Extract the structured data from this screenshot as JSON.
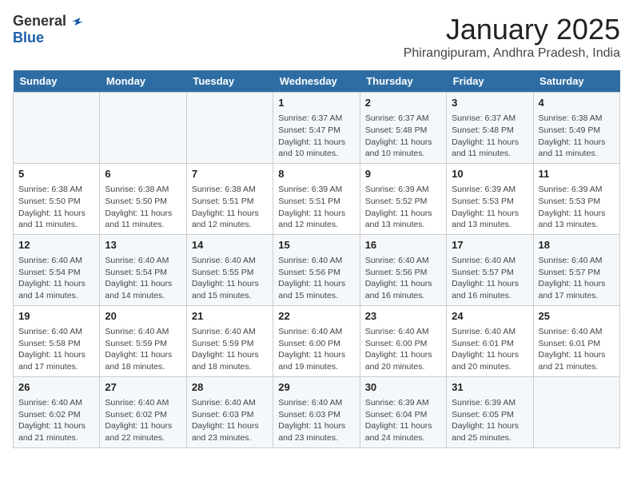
{
  "header": {
    "logo_general": "General",
    "logo_blue": "Blue",
    "month": "January 2025",
    "location": "Phirangipuram, Andhra Pradesh, India"
  },
  "days_of_week": [
    "Sunday",
    "Monday",
    "Tuesday",
    "Wednesday",
    "Thursday",
    "Friday",
    "Saturday"
  ],
  "weeks": [
    [
      {
        "day": "",
        "info": ""
      },
      {
        "day": "",
        "info": ""
      },
      {
        "day": "",
        "info": ""
      },
      {
        "day": "1",
        "info": "Sunrise: 6:37 AM\nSunset: 5:47 PM\nDaylight: 11 hours\nand 10 minutes."
      },
      {
        "day": "2",
        "info": "Sunrise: 6:37 AM\nSunset: 5:48 PM\nDaylight: 11 hours\nand 10 minutes."
      },
      {
        "day": "3",
        "info": "Sunrise: 6:37 AM\nSunset: 5:48 PM\nDaylight: 11 hours\nand 11 minutes."
      },
      {
        "day": "4",
        "info": "Sunrise: 6:38 AM\nSunset: 5:49 PM\nDaylight: 11 hours\nand 11 minutes."
      }
    ],
    [
      {
        "day": "5",
        "info": "Sunrise: 6:38 AM\nSunset: 5:50 PM\nDaylight: 11 hours\nand 11 minutes."
      },
      {
        "day": "6",
        "info": "Sunrise: 6:38 AM\nSunset: 5:50 PM\nDaylight: 11 hours\nand 11 minutes."
      },
      {
        "day": "7",
        "info": "Sunrise: 6:38 AM\nSunset: 5:51 PM\nDaylight: 11 hours\nand 12 minutes."
      },
      {
        "day": "8",
        "info": "Sunrise: 6:39 AM\nSunset: 5:51 PM\nDaylight: 11 hours\nand 12 minutes."
      },
      {
        "day": "9",
        "info": "Sunrise: 6:39 AM\nSunset: 5:52 PM\nDaylight: 11 hours\nand 13 minutes."
      },
      {
        "day": "10",
        "info": "Sunrise: 6:39 AM\nSunset: 5:53 PM\nDaylight: 11 hours\nand 13 minutes."
      },
      {
        "day": "11",
        "info": "Sunrise: 6:39 AM\nSunset: 5:53 PM\nDaylight: 11 hours\nand 13 minutes."
      }
    ],
    [
      {
        "day": "12",
        "info": "Sunrise: 6:40 AM\nSunset: 5:54 PM\nDaylight: 11 hours\nand 14 minutes."
      },
      {
        "day": "13",
        "info": "Sunrise: 6:40 AM\nSunset: 5:54 PM\nDaylight: 11 hours\nand 14 minutes."
      },
      {
        "day": "14",
        "info": "Sunrise: 6:40 AM\nSunset: 5:55 PM\nDaylight: 11 hours\nand 15 minutes."
      },
      {
        "day": "15",
        "info": "Sunrise: 6:40 AM\nSunset: 5:56 PM\nDaylight: 11 hours\nand 15 minutes."
      },
      {
        "day": "16",
        "info": "Sunrise: 6:40 AM\nSunset: 5:56 PM\nDaylight: 11 hours\nand 16 minutes."
      },
      {
        "day": "17",
        "info": "Sunrise: 6:40 AM\nSunset: 5:57 PM\nDaylight: 11 hours\nand 16 minutes."
      },
      {
        "day": "18",
        "info": "Sunrise: 6:40 AM\nSunset: 5:57 PM\nDaylight: 11 hours\nand 17 minutes."
      }
    ],
    [
      {
        "day": "19",
        "info": "Sunrise: 6:40 AM\nSunset: 5:58 PM\nDaylight: 11 hours\nand 17 minutes."
      },
      {
        "day": "20",
        "info": "Sunrise: 6:40 AM\nSunset: 5:59 PM\nDaylight: 11 hours\nand 18 minutes."
      },
      {
        "day": "21",
        "info": "Sunrise: 6:40 AM\nSunset: 5:59 PM\nDaylight: 11 hours\nand 18 minutes."
      },
      {
        "day": "22",
        "info": "Sunrise: 6:40 AM\nSunset: 6:00 PM\nDaylight: 11 hours\nand 19 minutes."
      },
      {
        "day": "23",
        "info": "Sunrise: 6:40 AM\nSunset: 6:00 PM\nDaylight: 11 hours\nand 20 minutes."
      },
      {
        "day": "24",
        "info": "Sunrise: 6:40 AM\nSunset: 6:01 PM\nDaylight: 11 hours\nand 20 minutes."
      },
      {
        "day": "25",
        "info": "Sunrise: 6:40 AM\nSunset: 6:01 PM\nDaylight: 11 hours\nand 21 minutes."
      }
    ],
    [
      {
        "day": "26",
        "info": "Sunrise: 6:40 AM\nSunset: 6:02 PM\nDaylight: 11 hours\nand 21 minutes."
      },
      {
        "day": "27",
        "info": "Sunrise: 6:40 AM\nSunset: 6:02 PM\nDaylight: 11 hours\nand 22 minutes."
      },
      {
        "day": "28",
        "info": "Sunrise: 6:40 AM\nSunset: 6:03 PM\nDaylight: 11 hours\nand 23 minutes."
      },
      {
        "day": "29",
        "info": "Sunrise: 6:40 AM\nSunset: 6:03 PM\nDaylight: 11 hours\nand 23 minutes."
      },
      {
        "day": "30",
        "info": "Sunrise: 6:39 AM\nSunset: 6:04 PM\nDaylight: 11 hours\nand 24 minutes."
      },
      {
        "day": "31",
        "info": "Sunrise: 6:39 AM\nSunset: 6:05 PM\nDaylight: 11 hours\nand 25 minutes."
      },
      {
        "day": "",
        "info": ""
      }
    ]
  ]
}
